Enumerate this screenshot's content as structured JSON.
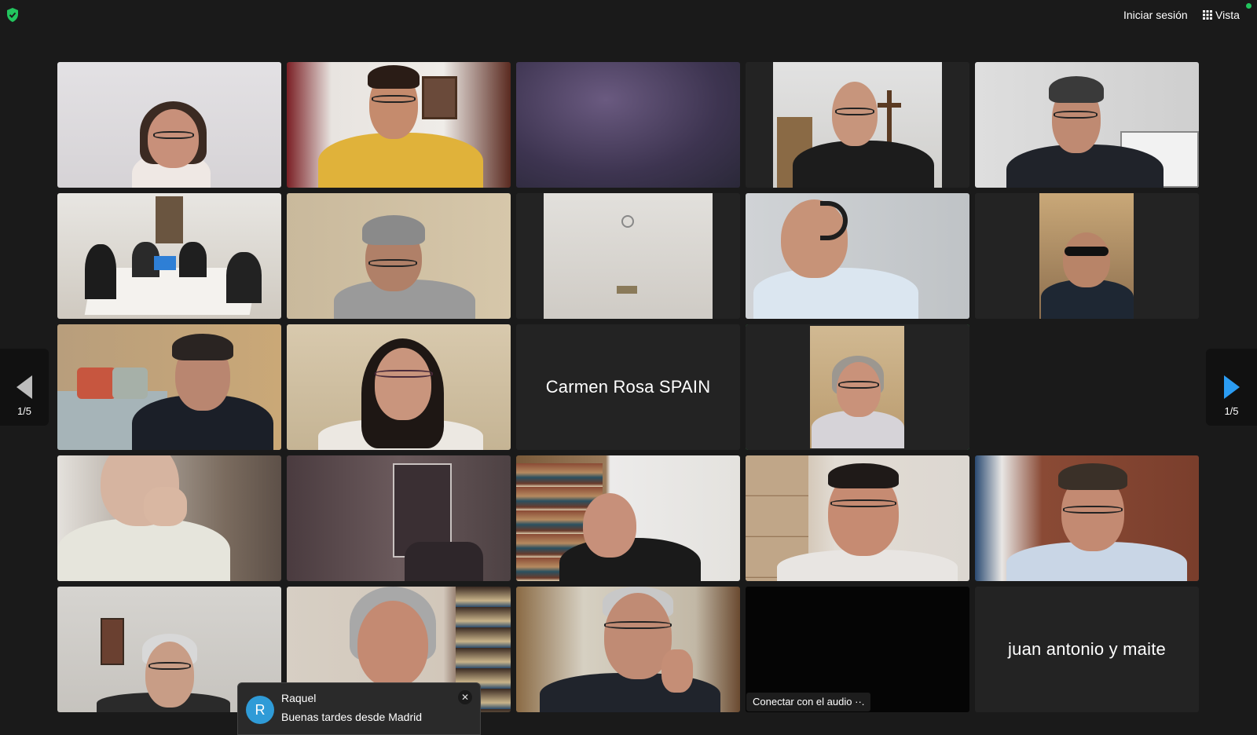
{
  "topbar": {
    "signin_label": "Iniciar sesión",
    "view_label": "Vista",
    "security_icon": "shield-check-icon",
    "view_icon": "grid-icon",
    "status_color": "#22c55e"
  },
  "gallery": {
    "tiles": [
      {
        "name": "Carmen Rosa SPAIN"
      },
      {
        "name": "juan antonio y maite"
      }
    ],
    "audio_chip_label": "Conectar con el audio",
    "audio_chip_more": "··.",
    "active_speaker_color": "#35c759"
  },
  "pagination": {
    "left_page": "1/5",
    "right_page": "1/5"
  },
  "chat_toast": {
    "avatar_initial": "R",
    "sender": "Raquel",
    "message": "Buenas tardes desde Madrid",
    "close_glyph": "✕"
  }
}
